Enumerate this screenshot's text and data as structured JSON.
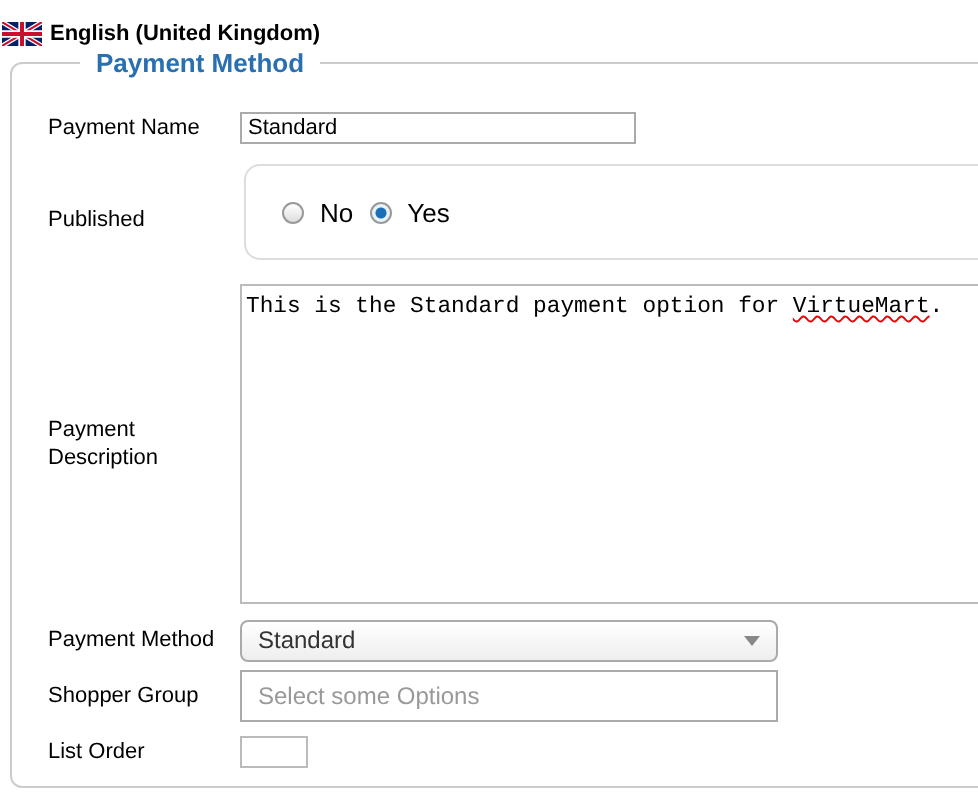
{
  "language": {
    "label": "English (United Kingdom)"
  },
  "fieldset": {
    "legend": "Payment Method",
    "fields": [
      {
        "kind": "text",
        "label": "Payment Name",
        "value": "Standard"
      },
      {
        "kind": "radio",
        "label": "Published",
        "options": [
          {
            "label": "No",
            "selected": false
          },
          {
            "label": "Yes",
            "selected": true
          }
        ]
      },
      {
        "kind": "textarea",
        "label": "Payment Description",
        "value": "This is the Standard payment option for ",
        "misspelled": "VirtueMart",
        "tail": "."
      },
      {
        "kind": "select",
        "label": "Payment Method",
        "value": "Standard"
      },
      {
        "kind": "multiselect",
        "label": "Shopper Group",
        "placeholder": "Select some Options"
      },
      {
        "kind": "short",
        "label": "List Order"
      }
    ]
  }
}
